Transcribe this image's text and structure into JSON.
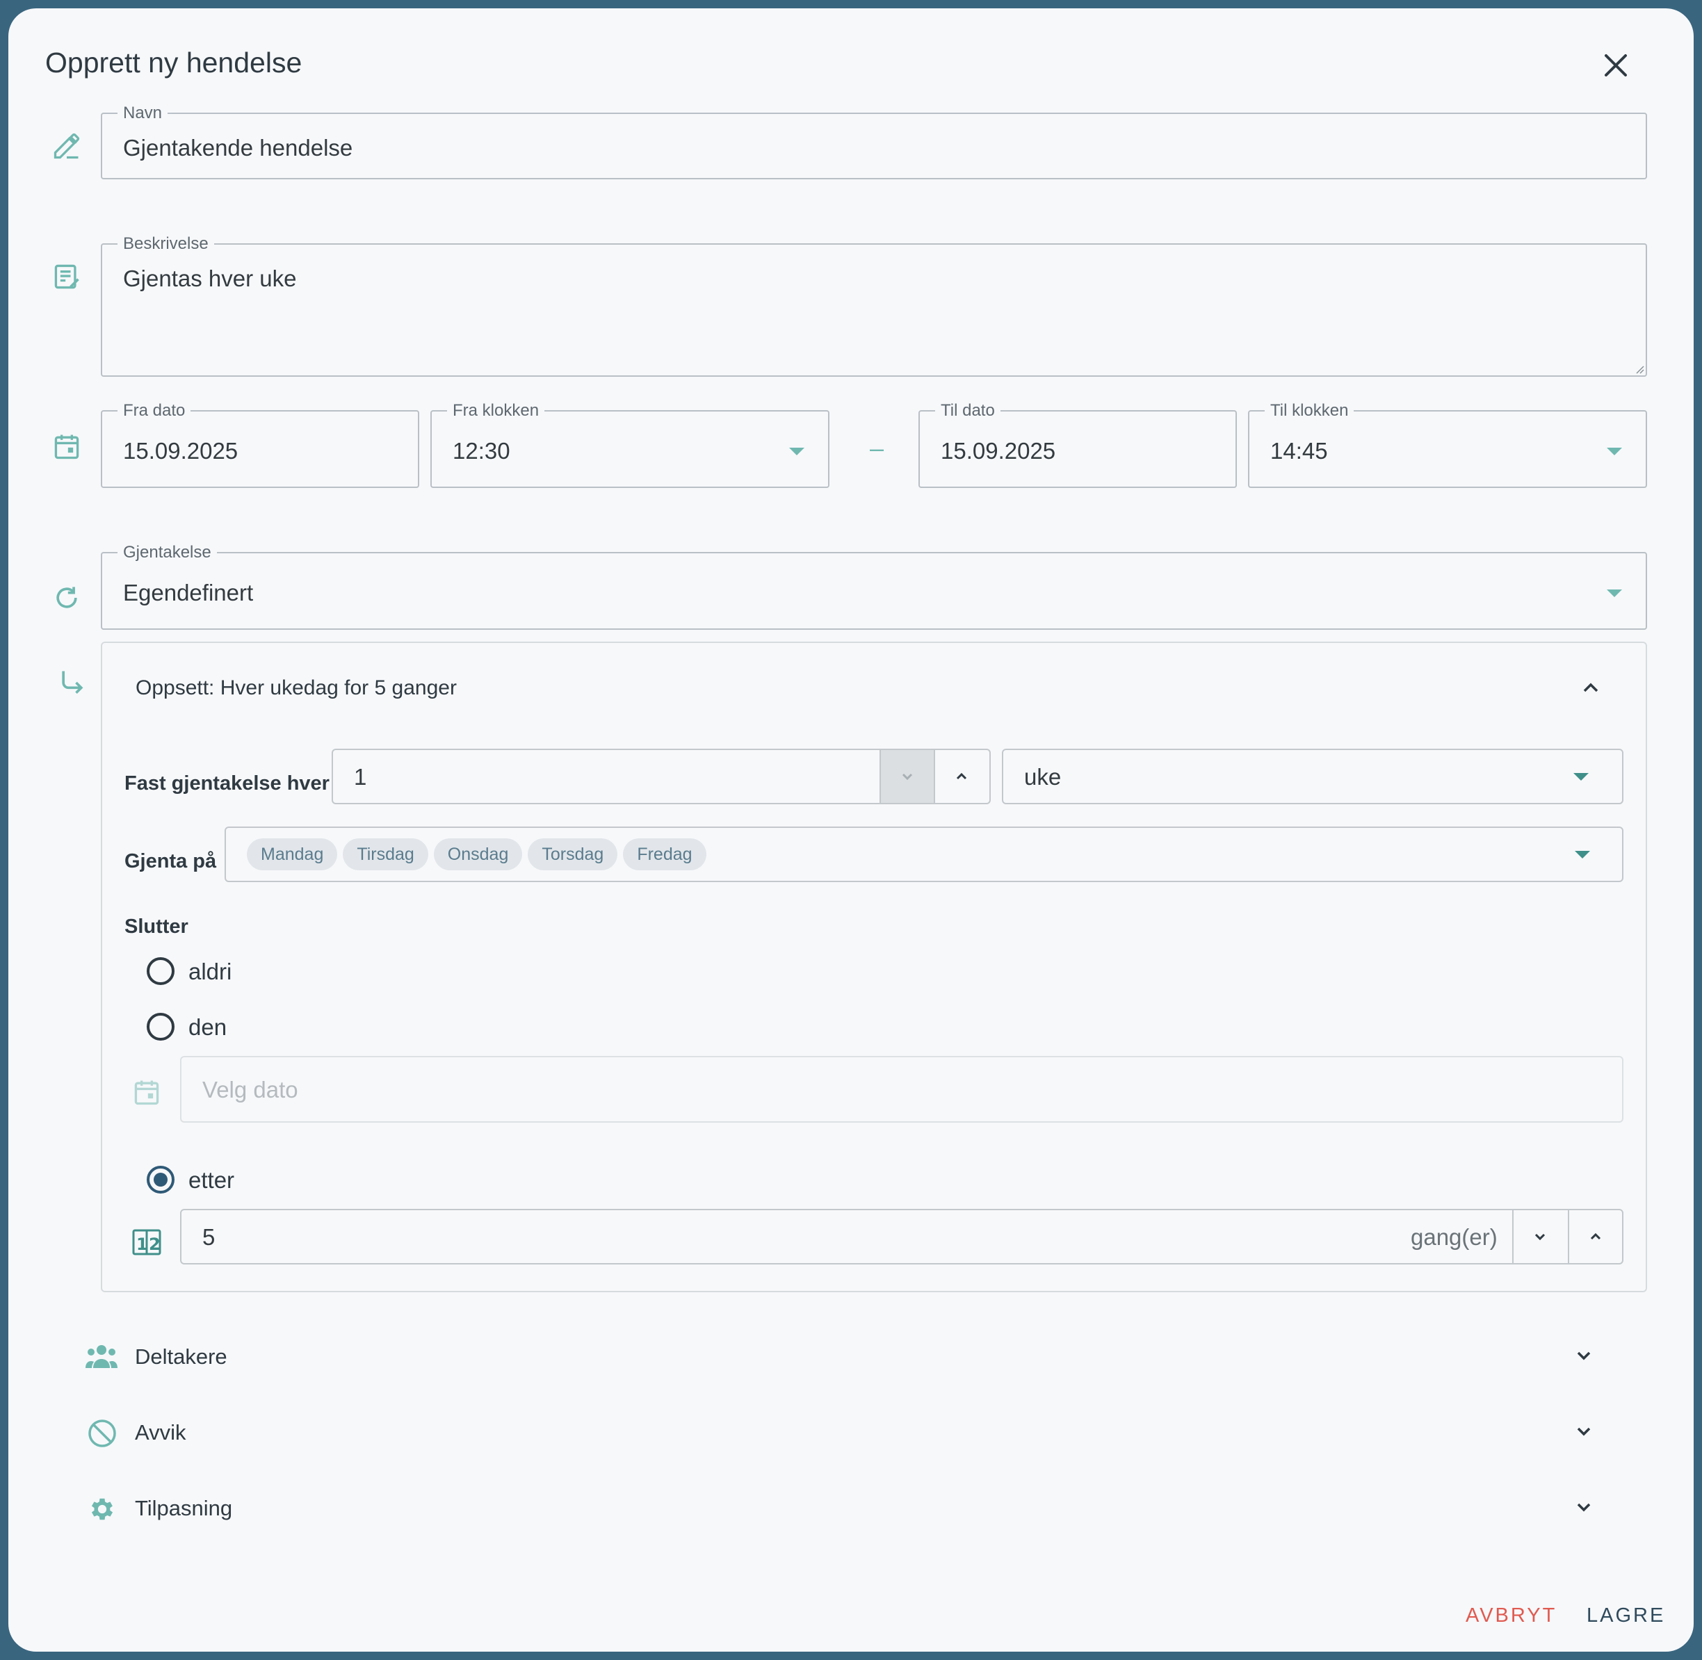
{
  "dialog": {
    "title": "Opprett ny hendelse"
  },
  "fields": {
    "name": {
      "label": "Navn",
      "value": "Gjentakende hendelse"
    },
    "description": {
      "label": "Beskrivelse",
      "value": "Gjentas hver uke"
    },
    "from_date": {
      "label": "Fra dato",
      "value": "15.09.2025"
    },
    "from_time": {
      "label": "Fra klokken",
      "value": "12:30"
    },
    "separator": "–",
    "to_date": {
      "label": "Til dato",
      "value": "15.09.2025"
    },
    "to_time": {
      "label": "Til klokken",
      "value": "14:45"
    },
    "recurrence": {
      "label": "Gjentakelse",
      "value": "Egendefinert"
    }
  },
  "setup": {
    "summary": "Oppsett: Hver ukedag for 5 ganger",
    "interval_label": "Fast gjentakelse hver",
    "interval_value": "1",
    "interval_unit": "uke",
    "repeat_on_label": "Gjenta på",
    "days": [
      "Mandag",
      "Tirsdag",
      "Onsdag",
      "Torsdag",
      "Fredag"
    ],
    "ends_label": "Slutter",
    "ends_options": {
      "never": "aldri",
      "on": "den",
      "after": "etter"
    },
    "selected_end": "after",
    "date_placeholder": "Velg dato",
    "count_value": "5",
    "count_suffix": "gang(er)"
  },
  "sections": {
    "participants": "Deltakere",
    "exceptions": "Avvik",
    "customization": "Tilpasning"
  },
  "footer": {
    "cancel": "AVBRYT",
    "save": "LAGRE"
  },
  "colors": {
    "accent": "#6fb8b0",
    "brand": "#2f5a77",
    "cancel": "#e05a50",
    "background": "#39657f"
  }
}
